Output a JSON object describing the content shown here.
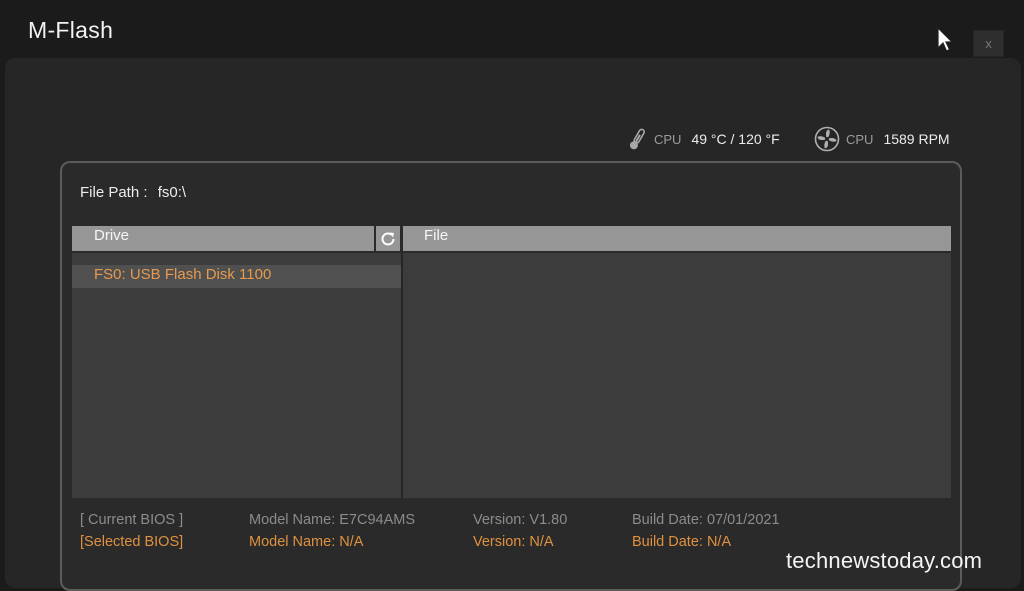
{
  "app": {
    "title": "M-Flash",
    "close_label": "x"
  },
  "status": {
    "temp": {
      "icon": "thermometer-icon",
      "label": "CPU",
      "value": "49 °C / 120 °F"
    },
    "fan": {
      "icon": "fan-icon",
      "label": "CPU",
      "value": "1589 RPM"
    }
  },
  "file_path": {
    "label": "File Path :",
    "value": "fs0:\\"
  },
  "drive_panel": {
    "header": "Drive",
    "refresh_icon": "refresh-icon",
    "items": [
      {
        "label": "FS0: USB Flash Disk 1100",
        "selected": true
      }
    ]
  },
  "file_panel": {
    "header": "File",
    "items": []
  },
  "bios_info": {
    "current": {
      "label": "[ Current BIOS ]",
      "model": "Model Name: E7C94AMS",
      "version": "Version: V1.80",
      "build_date": "Build Date: 07/01/2021"
    },
    "selected": {
      "label": "[Selected BIOS]",
      "model": "Model Name: N/A",
      "version": "Version: N/A",
      "build_date": "Build Date: N/A"
    }
  },
  "watermark": "technewstoday.com",
  "colors": {
    "accent_orange": "#e0913f",
    "header_gray": "#969696",
    "pane_bg": "#3c3c3c",
    "background": "#1b1b1b"
  }
}
